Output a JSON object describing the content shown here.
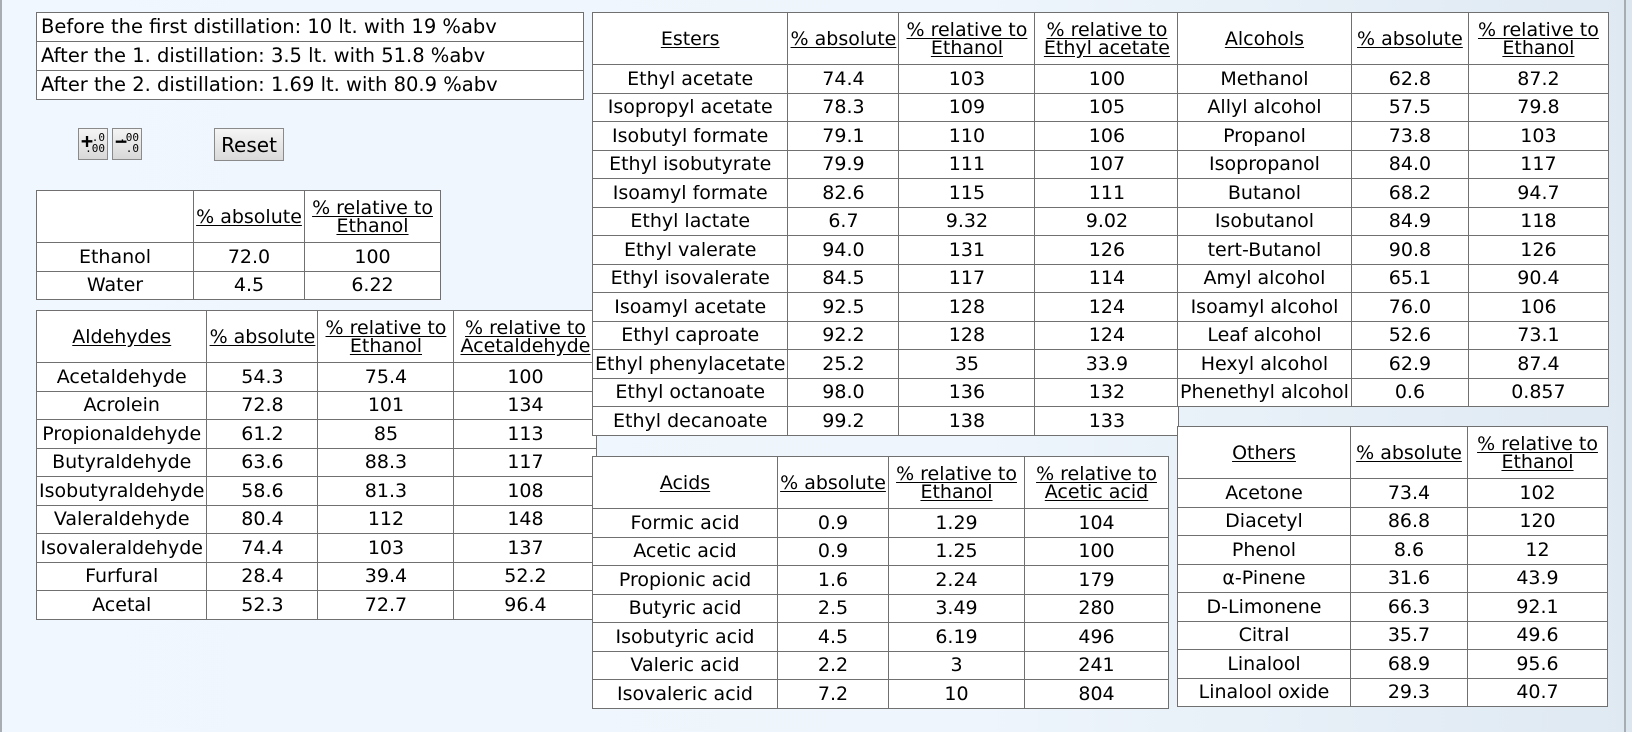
{
  "info": [
    "Before the first distillation: 10 lt. with 19 %abv",
    "After the 1. distillation: 3.5 lt. with 51.8 %abv",
    "After the 2. distillation: 1.69 lt. with 80.9 %abv"
  ],
  "controls": {
    "increase_decimals": {
      "icon": "increase-decimals-icon",
      "big": "+",
      "small_top": ".0",
      "small_bottom": ".00"
    },
    "decrease_decimals": {
      "icon": "decrease-decimals-icon",
      "big": "−",
      "small_top": ".00",
      "small_bottom": ".0"
    },
    "reset_label": "Reset"
  },
  "ethanol_table": {
    "headers": [
      "",
      "% absolute",
      "% relative to Ethanol"
    ],
    "rows": [
      [
        "Ethanol",
        "72.0",
        "100"
      ],
      [
        "Water",
        "4.5",
        "6.22"
      ]
    ]
  },
  "aldehydes_table": {
    "headers": [
      "Aldehydes",
      "% absolute",
      "% relative to Ethanol",
      "% relative to Acetaldehyde"
    ],
    "rows": [
      [
        "Acetaldehyde",
        "54.3",
        "75.4",
        "100"
      ],
      [
        "Acrolein",
        "72.8",
        "101",
        "134"
      ],
      [
        "Propionaldehyde",
        "61.2",
        "85",
        "113"
      ],
      [
        "Butyraldehyde",
        "63.6",
        "88.3",
        "117"
      ],
      [
        "Isobutyraldehyde",
        "58.6",
        "81.3",
        "108"
      ],
      [
        "Valeraldehyde",
        "80.4",
        "112",
        "148"
      ],
      [
        "Isovaleraldehyde",
        "74.4",
        "103",
        "137"
      ],
      [
        "Furfural",
        "28.4",
        "39.4",
        "52.2"
      ],
      [
        "Acetal",
        "52.3",
        "72.7",
        "96.4"
      ]
    ]
  },
  "esters_table": {
    "headers": [
      "Esters",
      "% absolute",
      "% relative to Ethanol",
      "% relative to Ethyl acetate"
    ],
    "rows": [
      [
        "Ethyl acetate",
        "74.4",
        "103",
        "100"
      ],
      [
        "Isopropyl acetate",
        "78.3",
        "109",
        "105"
      ],
      [
        "Isobutyl formate",
        "79.1",
        "110",
        "106"
      ],
      [
        "Ethyl isobutyrate",
        "79.9",
        "111",
        "107"
      ],
      [
        "Isoamyl formate",
        "82.6",
        "115",
        "111"
      ],
      [
        "Ethyl lactate",
        "6.7",
        "9.32",
        "9.02"
      ],
      [
        "Ethyl valerate",
        "94.0",
        "131",
        "126"
      ],
      [
        "Ethyl isovalerate",
        "84.5",
        "117",
        "114"
      ],
      [
        "Isoamyl acetate",
        "92.5",
        "128",
        "124"
      ],
      [
        "Ethyl caproate",
        "92.2",
        "128",
        "124"
      ],
      [
        "Ethyl phenylacetate",
        "25.2",
        "35",
        "33.9"
      ],
      [
        "Ethyl octanoate",
        "98.0",
        "136",
        "132"
      ],
      [
        "Ethyl decanoate",
        "99.2",
        "138",
        "133"
      ]
    ]
  },
  "acids_table": {
    "headers": [
      "Acids",
      "% absolute",
      "% relative to Ethanol",
      "% relative to Acetic acid"
    ],
    "rows": [
      [
        "Formic acid",
        "0.9",
        "1.29",
        "104"
      ],
      [
        "Acetic acid",
        "0.9",
        "1.25",
        "100"
      ],
      [
        "Propionic acid",
        "1.6",
        "2.24",
        "179"
      ],
      [
        "Butyric acid",
        "2.5",
        "3.49",
        "280"
      ],
      [
        "Isobutyric acid",
        "4.5",
        "6.19",
        "496"
      ],
      [
        "Valeric acid",
        "2.2",
        "3",
        "241"
      ],
      [
        "Isovaleric acid",
        "7.2",
        "10",
        "804"
      ]
    ]
  },
  "alcohols_table": {
    "headers": [
      "Alcohols",
      "% absolute",
      "% relative to Ethanol"
    ],
    "rows": [
      [
        "Methanol",
        "62.8",
        "87.2"
      ],
      [
        "Allyl alcohol",
        "57.5",
        "79.8"
      ],
      [
        "Propanol",
        "73.8",
        "103"
      ],
      [
        "Isopropanol",
        "84.0",
        "117"
      ],
      [
        "Butanol",
        "68.2",
        "94.7"
      ],
      [
        "Isobutanol",
        "84.9",
        "118"
      ],
      [
        "tert-Butanol",
        "90.8",
        "126"
      ],
      [
        "Amyl alcohol",
        "65.1",
        "90.4"
      ],
      [
        "Isoamyl alcohol",
        "76.0",
        "106"
      ],
      [
        "Leaf alcohol",
        "52.6",
        "73.1"
      ],
      [
        "Hexyl alcohol",
        "62.9",
        "87.4"
      ],
      [
        "Phenethyl alcohol",
        "0.6",
        "0.857"
      ]
    ]
  },
  "others_table": {
    "headers": [
      "Others",
      "% absolute",
      "% relative to Ethanol"
    ],
    "rows": [
      [
        "Acetone",
        "73.4",
        "102"
      ],
      [
        "Diacetyl",
        "86.8",
        "120"
      ],
      [
        "Phenol",
        "8.6",
        "12"
      ],
      [
        "α-Pinene",
        "31.6",
        "43.9"
      ],
      [
        "D-Limonene",
        "66.3",
        "92.1"
      ],
      [
        "Citral",
        "35.7",
        "49.6"
      ],
      [
        "Linalool",
        "68.9",
        "95.6"
      ],
      [
        "Linalool oxide",
        "29.3",
        "40.7"
      ]
    ]
  }
}
